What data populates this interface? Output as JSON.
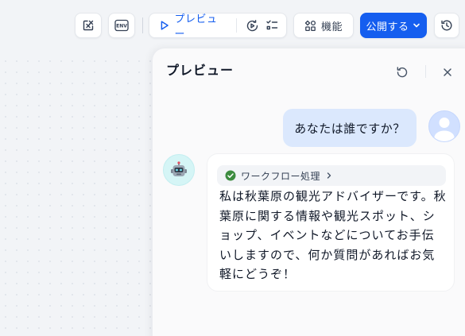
{
  "toolbar": {
    "preview_label": "プレビュー",
    "features_label": "機能",
    "publish_label": "公開する",
    "env_icon_text": "ENV",
    "accent_color": "#155eef"
  },
  "icons": {
    "clear": "variable-clear-icon",
    "env": "env-icon",
    "play": "play-icon",
    "run_history": "run-history-icon",
    "checklist": "checklist-icon",
    "features": "features-icon",
    "chevron": "chevron-down-icon",
    "history": "history-icon",
    "refresh": "refresh-icon",
    "close": "close-icon"
  },
  "panel": {
    "title": "プレビュー",
    "messages": [
      {
        "role": "user",
        "text": "あなたは誰ですか？"
      },
      {
        "role": "assistant",
        "workflow_label": "ワークフロー処理",
        "workflow_status_color": "#3d8c40",
        "text": "私は秋葉原の観光アドバイザーです。秋葉原に関する情報や観光スポット、ショップ、イベントなどについてお手伝いしますので、何か質問があればお気軽にどうぞ！"
      }
    ]
  }
}
